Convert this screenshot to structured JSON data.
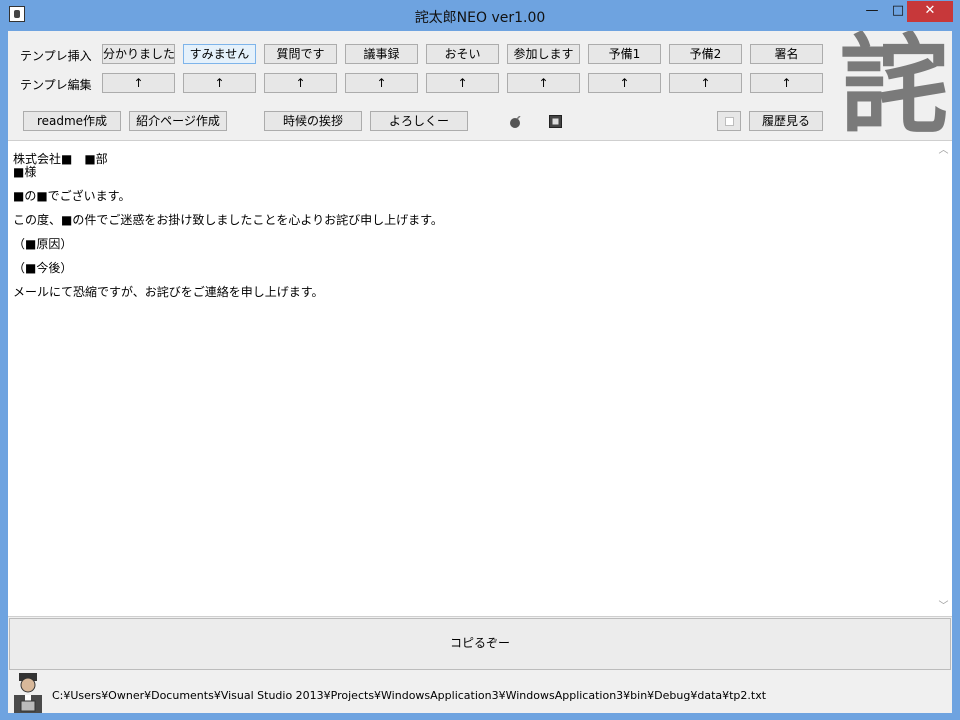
{
  "window": {
    "title": "詫太郎NEO  ver1.00",
    "controls": {
      "minimize": "—",
      "maximize": "□",
      "close": "✕"
    }
  },
  "toolbar": {
    "row1_label": "テンプレ挿入",
    "row2_label": "テンプレ編集",
    "templates": [
      "分かりました",
      "すみません",
      "質問です",
      "議事録",
      "おそい",
      "参加します",
      "予備1",
      "予備2",
      "署名"
    ],
    "edit_arrows": [
      "↑",
      "↑",
      "↑",
      "↑",
      "↑",
      "↑",
      "↑",
      "↑",
      "↑"
    ],
    "actions": {
      "readme": "readme作成",
      "intro_page": "紹介ページ作成",
      "seasonal_greeting": "時候の挨拶",
      "regards": "よろしくー",
      "history": "履歴見る"
    },
    "logo_char": "詫"
  },
  "editor": {
    "lines": [
      "株式会社■　■部\n■様",
      "■の■でございます。",
      "この度、■の件でご迷惑をお掛け致しましたことを心よりお詫び申し上げます。",
      "（■原因）",
      "（■今後）",
      "メールにて恐縮ですが、お詫びをご連絡を申し上げます。"
    ]
  },
  "copy_button": "コピるぞー",
  "status": {
    "file_path": "C:¥Users¥Owner¥Documents¥Visual Studio 2013¥Projects¥WindowsApplication3¥WindowsApplication3¥bin¥Debug¥data¥tp2.txt"
  },
  "colors": {
    "titlebar": "#6ea3e0",
    "close_button": "#c7383a",
    "hover_button": "#e5f1fb"
  },
  "icons": [
    "app-icon",
    "bomb-icon",
    "stop-icon",
    "avatar-icon",
    "scroll-up-icon",
    "scroll-down-icon"
  ]
}
